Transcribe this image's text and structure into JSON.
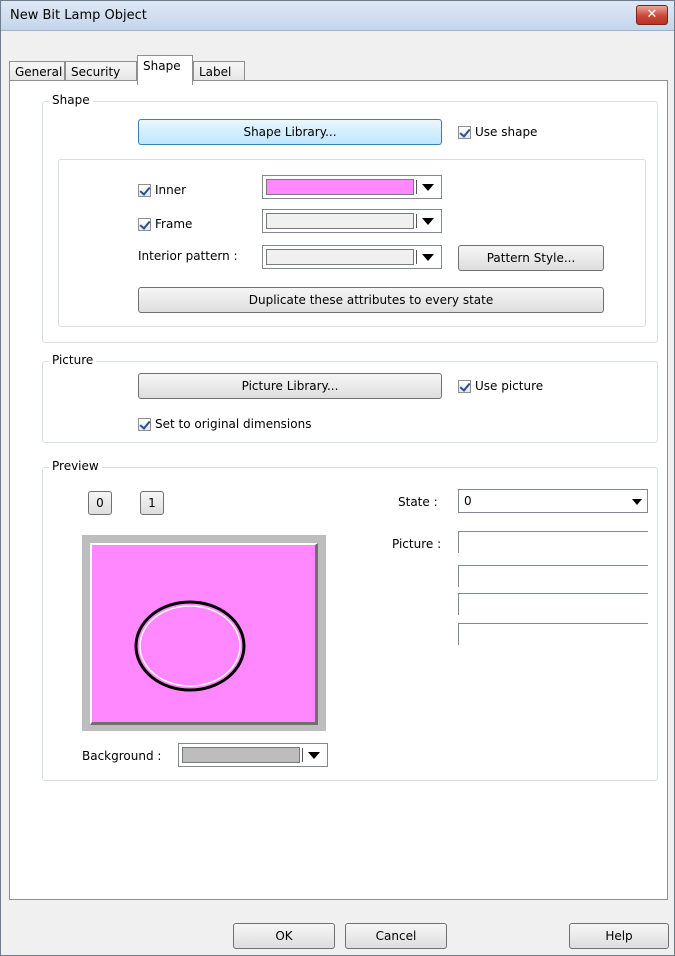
{
  "window": {
    "title": "New  Bit Lamp Object",
    "close_glyph": "✕"
  },
  "tabs": [
    {
      "label": "General"
    },
    {
      "label": "Security"
    },
    {
      "label": "Shape"
    },
    {
      "label": "Label"
    }
  ],
  "active_tab": "Shape",
  "shape_group": {
    "label": "Shape",
    "library_button": "Shape Library...",
    "use_shape": {
      "label": "Use shape",
      "checked": true
    },
    "inner": {
      "label": "Inner",
      "checked": true,
      "color": "#ff88ff"
    },
    "frame": {
      "label": "Frame",
      "checked": true,
      "color": "#f0f0f0"
    },
    "interior_pattern": {
      "label": "Interior pattern :",
      "color": "#f0f0f0"
    },
    "pattern_style_button": "Pattern Style...",
    "duplicate_button": "Duplicate these attributes to every state"
  },
  "picture_group": {
    "label": "Picture",
    "library_button": "Picture Library...",
    "use_picture": {
      "label": "Use picture",
      "checked": true
    },
    "original_dims": {
      "label": "Set to original dimensions",
      "checked": true
    }
  },
  "preview_group": {
    "label": "Preview",
    "state_buttons": [
      "0",
      "1"
    ],
    "state": {
      "label": "State :",
      "value": "0"
    },
    "picture_label": "Picture :",
    "background": {
      "label": "Background :",
      "color": "#bdbdbd"
    },
    "shape_fill_color": "#ff88ff"
  },
  "footer": {
    "ok_label": "OK",
    "cancel_label": "Cancel",
    "help_label": "Help"
  }
}
